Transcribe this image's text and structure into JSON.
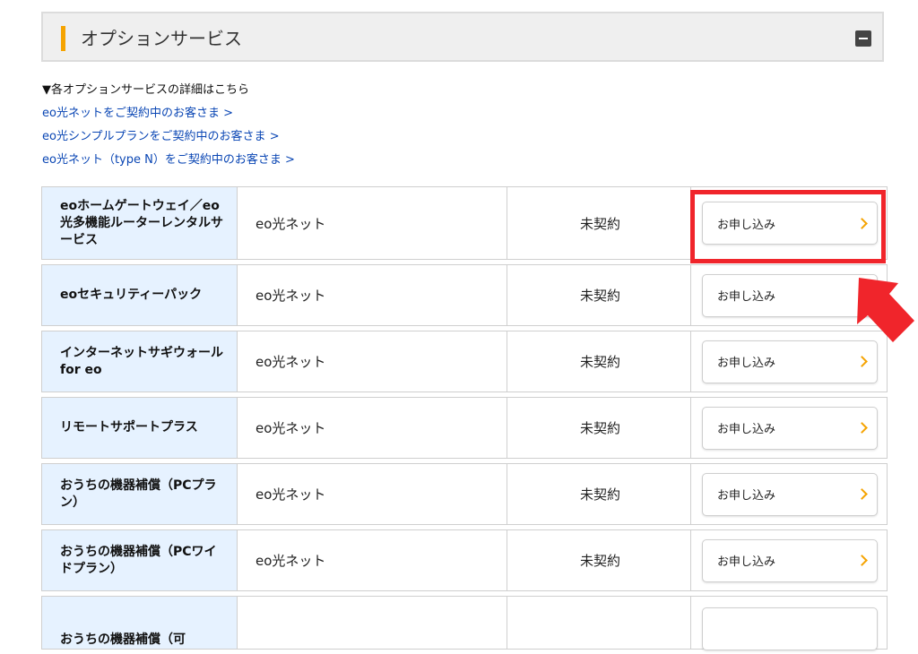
{
  "header": {
    "title": "オプションサービス"
  },
  "intro": "▼各オプションサービスの詳細はこちら",
  "links": [
    "eo光ネットをご契約中のお客さま >",
    "eo光シンプルプランをご契約中のお客さま >",
    "eo光ネット（type N）をご契約中のお客さま >"
  ],
  "rows": [
    {
      "name": "eoホームゲートウェイ／eo光多機能ルーターレンタルサービス",
      "net": "eo光ネット",
      "status": "未契約",
      "button": "お申し込み"
    },
    {
      "name": "eoセキュリティーパック",
      "net": "eo光ネット",
      "status": "未契約",
      "button": "お申し込み"
    },
    {
      "name": "インターネットサギウォール for eo",
      "net": "eo光ネット",
      "status": "未契約",
      "button": "お申し込み"
    },
    {
      "name": "リモートサポートプラス",
      "net": "eo光ネット",
      "status": "未契約",
      "button": "お申し込み"
    },
    {
      "name": "おうちの機器補償（PCプラン）",
      "net": "eo光ネット",
      "status": "未契約",
      "button": "お申し込み"
    },
    {
      "name": "おうちの機器補償（PCワイドプラン）",
      "net": "eo光ネット",
      "status": "未契約",
      "button": "お申し込み"
    },
    {
      "name": "おうちの機器補償（可",
      "net": "",
      "status": "",
      "button": ""
    }
  ],
  "colors": {
    "accent": "#f5a300",
    "link": "#0a46b4",
    "name_bg": "#e6f2ff",
    "highlight": "#f0252b"
  }
}
